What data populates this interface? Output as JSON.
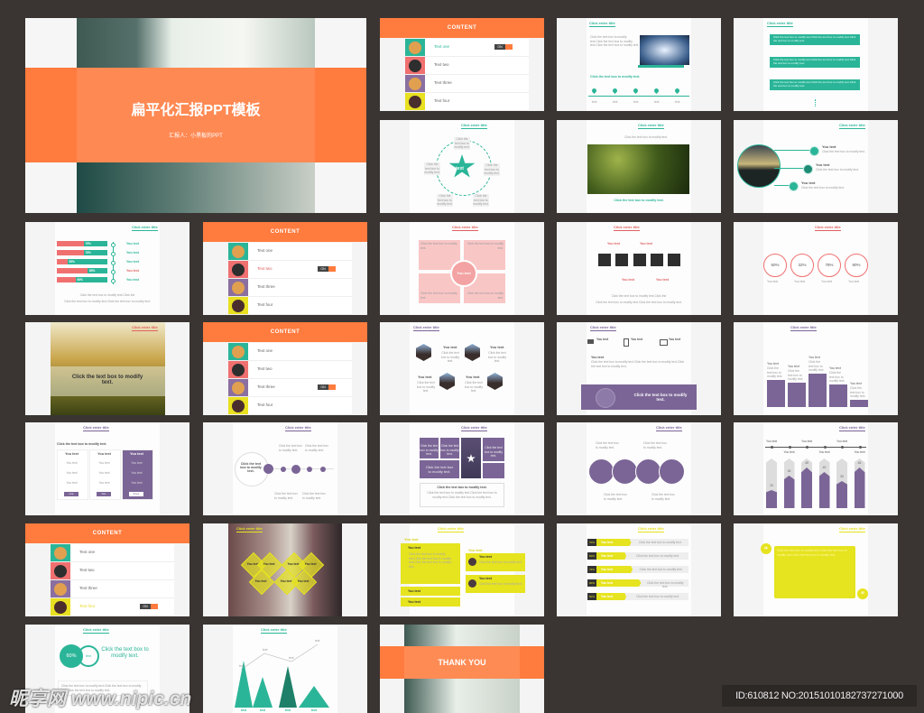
{
  "cover": {
    "title": "扁平化汇报PPT模板",
    "subtitle": "汇报人：小黑板的PPT"
  },
  "common": {
    "title": "Click enter title",
    "modify": "Click the text box to modify text.",
    "modify_lines": "Click the text box to modify text.Click the text box to modify text.Click the text box to modify text.",
    "modify_short": "Click the text box to modify text.",
    "you": "You text",
    "text": "text",
    "bottom_line1": "Click the text box to modify text.Click the",
    "bottom_line2": "Click the text box to modify text.Click the text box to modify text."
  },
  "content_slides": [
    {
      "header": "CONTENT",
      "items": [
        "Text one",
        "Text two",
        "Text three",
        "Text four"
      ],
      "active": 0,
      "toggle": "ON",
      "active_color": "#2bb598"
    },
    {
      "header": "CONTENT",
      "items": [
        "Text one",
        "Text two",
        "Text three",
        "Text four"
      ],
      "active": 1,
      "toggle": "ON",
      "active_color": "#e06060"
    },
    {
      "header": "CONTENT",
      "items": [
        "Text one",
        "Text two",
        "Text three",
        "Text four"
      ],
      "active": 2,
      "toggle": "ON",
      "active_color": "#666666"
    },
    {
      "header": "CONTENT",
      "items": [
        "Text one",
        "Text two",
        "Text three",
        "Text four"
      ],
      "active": 3,
      "toggle": "ON",
      "active_color": "#e6d820"
    }
  ],
  "progress_bars": {
    "values": [
      "75%",
      "75%",
      "55%",
      "80%",
      "65%"
    ]
  },
  "rings": {
    "values": [
      "50%",
      "32%",
      "78%",
      "90%"
    ],
    "percent": [
      50,
      32,
      78,
      90
    ]
  },
  "table": {
    "buttons": [
      "one",
      "two",
      "three"
    ]
  },
  "arrow_bars": {
    "values": [
      "20",
      "36",
      "45",
      "40",
      "30",
      "45"
    ]
  },
  "yellow_bars": {
    "values": [
      "70%",
      "60%",
      "73%",
      "90%",
      "60%"
    ]
  },
  "donut": {
    "value": "60%",
    "label": "text",
    "caption": "Click the text box to modify text."
  },
  "thanks": "THANK YOU",
  "watermark": {
    "logo": "昵享网 www.nipic.cn",
    "id_text": "ID:610812 NO:20151010182737271000"
  },
  "colors": {
    "background": "#3a3532",
    "orange": "#ff7b3e",
    "teal": "#2bb598",
    "coral": "#f07070",
    "purple": "#7b6596",
    "yellow": "#e6e31f"
  }
}
